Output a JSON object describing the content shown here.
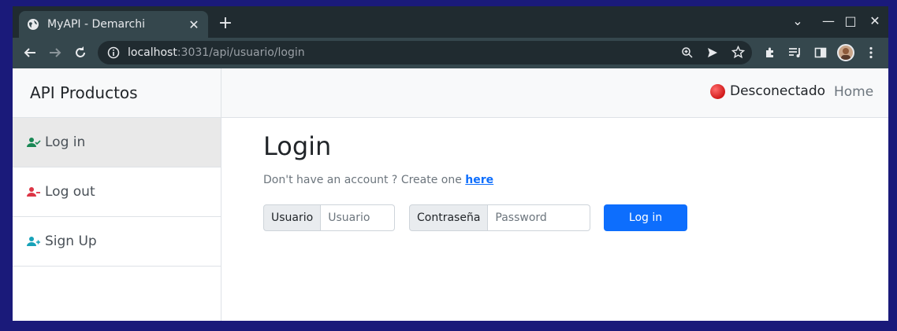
{
  "browser": {
    "tab_title": "MyAPI - Demarchi",
    "new_tab": "+",
    "url_host": "localhost",
    "url_rest": ":3031/api/usuario/login",
    "window_controls": [
      "⌄",
      "—",
      "□",
      "✕"
    ]
  },
  "sidebar": {
    "brand": "API Productos",
    "items": [
      {
        "label": "Log in",
        "icon": "user-check-icon",
        "color": "#198754"
      },
      {
        "label": "Log out",
        "icon": "user-minus-icon",
        "color": "#dc3545"
      },
      {
        "label": "Sign Up",
        "icon": "user-plus-icon",
        "color": "#17a2b8"
      }
    ]
  },
  "topnav": {
    "status": "Desconectado",
    "status_color": "#dc3545",
    "home": "Home"
  },
  "main": {
    "title": "Login",
    "hint_text": "Don't have an account ? Create one ",
    "hint_link": "here",
    "user_label": "Usuario",
    "user_placeholder": "Usuario",
    "pass_label": "Contraseña",
    "pass_placeholder": "Password",
    "submit": "Log in"
  }
}
